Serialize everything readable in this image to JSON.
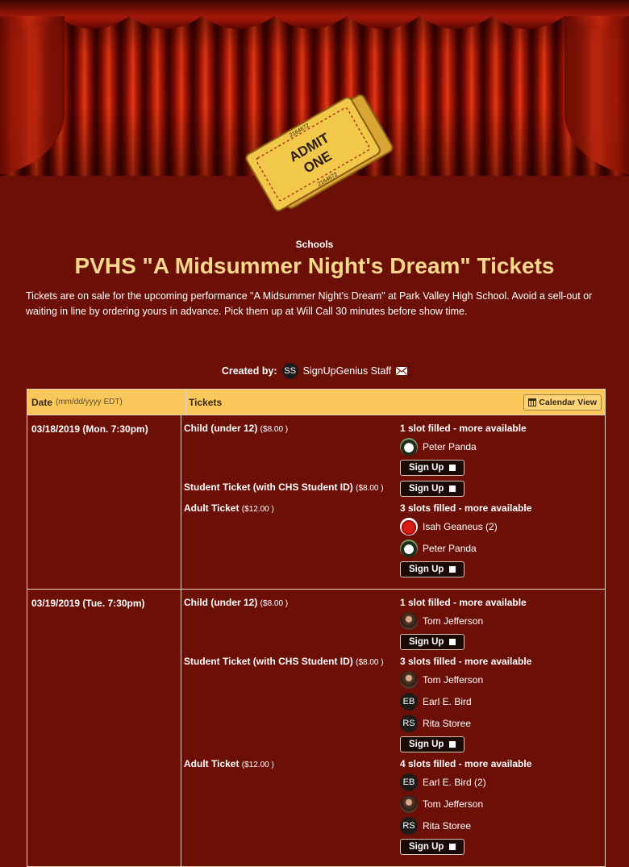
{
  "header": {
    "category": "Schools",
    "title": "PVHS \"A Midsummer Night's Dream\" Tickets",
    "description": "Tickets are on sale for the upcoming performance \"A Midsummer Night's Dream\" at Park Valley High School.  Avoid a sell-out or waiting in line by ordering yours in advance. Pick them up at Will Call 30 minutes before show time.",
    "ticket_art": {
      "line1": "ADMIT",
      "line2": "ONE",
      "serial": "2164672"
    }
  },
  "creator": {
    "label": "Created by:",
    "initials": "SS",
    "name": "SignUpGenius Staff",
    "icon": "envelope-icon"
  },
  "table": {
    "date_header": "Date",
    "date_format": "(mm/dd/yyyy EDT)",
    "tickets_header": "Tickets",
    "calendar_button": "Calendar View",
    "signup_label": "Sign Up",
    "rows": [
      {
        "date": "03/18/2019 (Mon. 7:30pm)",
        "slots": [
          {
            "name": "Child (under 12)",
            "price": "($8.00 )",
            "status": "1 slot filled - more available",
            "people": [
              {
                "name": "Peter Panda",
                "avatar": "panda"
              }
            ]
          },
          {
            "name": "Student Ticket (with CHS Student ID)",
            "price": "($8.00 )",
            "status": "",
            "people": []
          },
          {
            "name": "Adult Ticket",
            "price": "($12.00 )",
            "status": "3 slots filled - more available",
            "people": [
              {
                "name": "Isah Geaneus (2)",
                "avatar": "apple"
              },
              {
                "name": "Peter Panda",
                "avatar": "panda"
              }
            ]
          }
        ]
      },
      {
        "date": "03/19/2019 (Tue. 7:30pm)",
        "slots": [
          {
            "name": "Child (under 12)",
            "price": "($8.00 )",
            "status": "1 slot filled - more available",
            "people": [
              {
                "name": "Tom Jefferson",
                "avatar": "tom"
              }
            ]
          },
          {
            "name": "Student Ticket (with CHS Student ID)",
            "price": "($8.00 )",
            "status": "3 slots filled - more available",
            "people": [
              {
                "name": "Tom Jefferson",
                "avatar": "tom"
              },
              {
                "name": "Earl E. Bird",
                "avatar": "initials",
                "initials": "EB"
              },
              {
                "name": "Rita Storee",
                "avatar": "initials",
                "initials": "RS"
              }
            ]
          },
          {
            "name": "Adult Ticket",
            "price": "($12.00 )",
            "status": "4 slots filled - more available",
            "people": [
              {
                "name": "Earl E. Bird (2)",
                "avatar": "initials",
                "initials": "EB"
              },
              {
                "name": "Tom Jefferson",
                "avatar": "tom"
              },
              {
                "name": "Rita Storee",
                "avatar": "initials",
                "initials": "RS"
              }
            ]
          }
        ]
      }
    ]
  }
}
